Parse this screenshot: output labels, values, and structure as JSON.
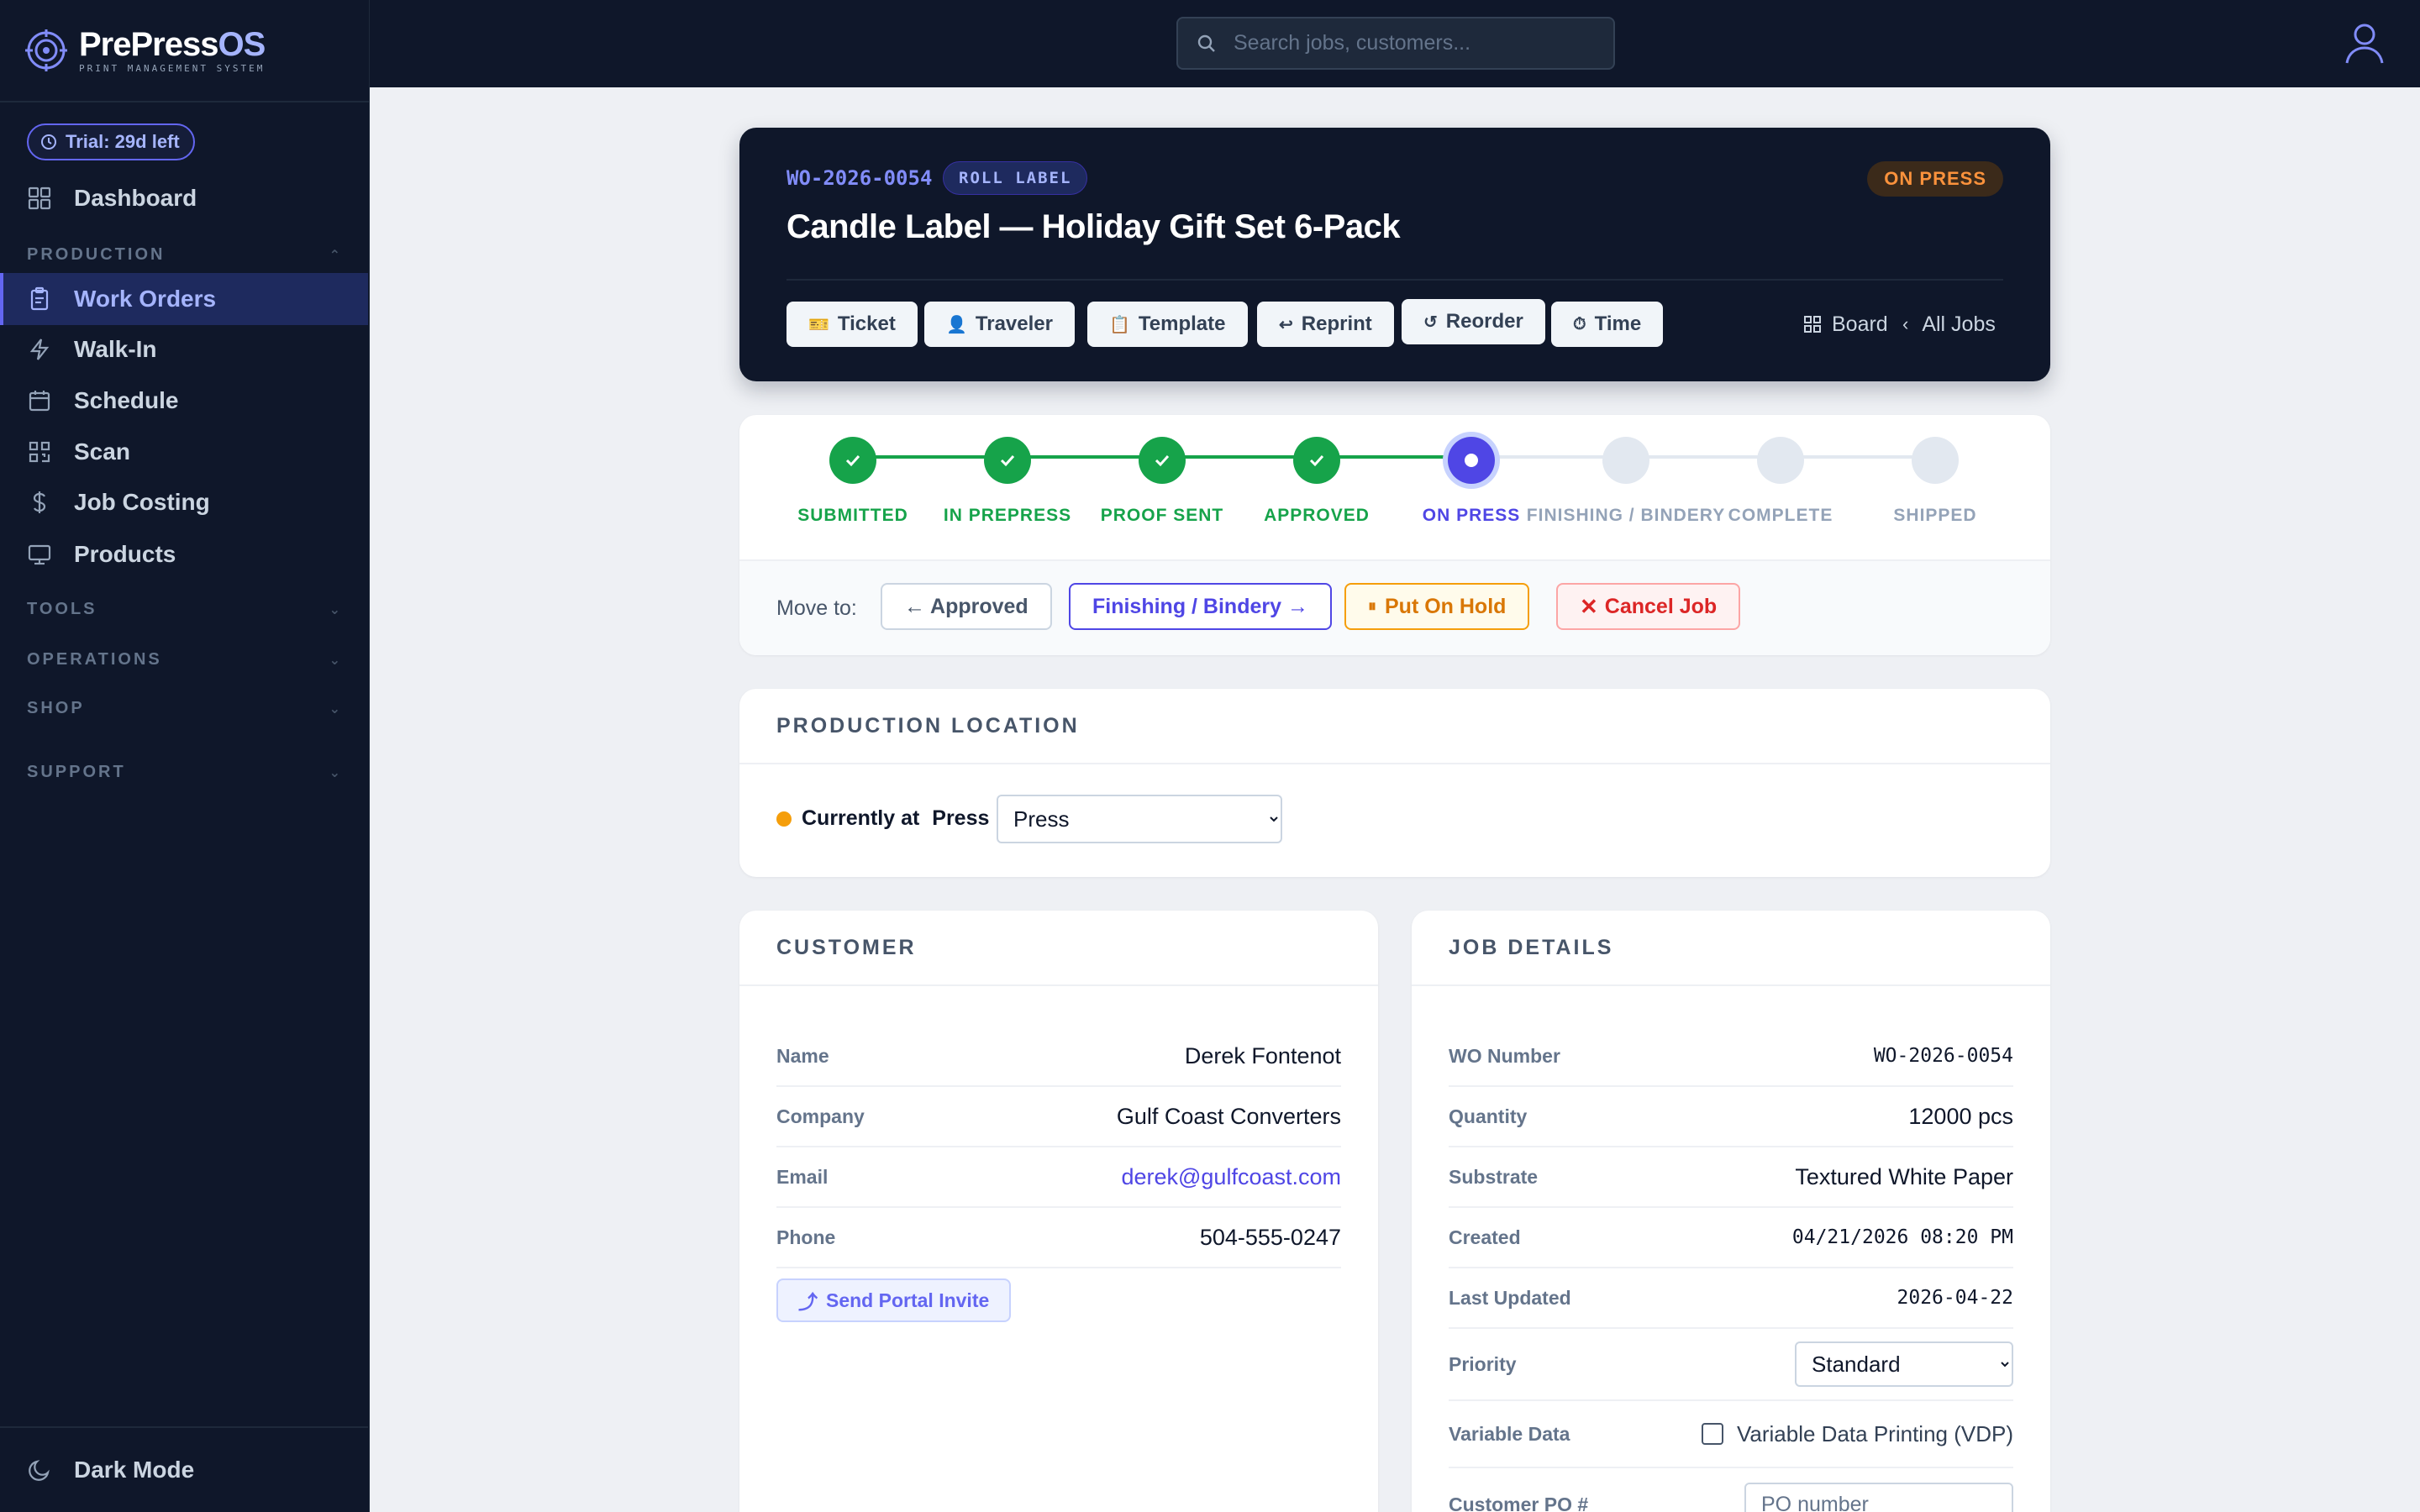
{
  "brand": {
    "name_a": "PrePress",
    "name_b": "OS",
    "tagline": "PRINT MANAGEMENT SYSTEM"
  },
  "sidebar": {
    "trial": "Trial: 29d left",
    "dashboard": "Dashboard",
    "sections": {
      "production": "PRODUCTION",
      "tools": "TOOLS",
      "operations": "OPERATIONS",
      "shop": "SHOP",
      "support": "SUPPORT"
    },
    "items": [
      {
        "label": "Work Orders",
        "icon": "clipboard-icon",
        "active": true
      },
      {
        "label": "Walk-In",
        "icon": "bolt-icon"
      },
      {
        "label": "Schedule",
        "icon": "calendar-icon"
      },
      {
        "label": "Scan",
        "icon": "qr-scan-icon"
      },
      {
        "label": "Job Costing",
        "icon": "dollar-icon"
      },
      {
        "label": "Products",
        "icon": "monitor-icon"
      }
    ],
    "dark_mode": "Dark Mode"
  },
  "topbar": {
    "search_placeholder": "Search jobs, customers..."
  },
  "header": {
    "wo_id": "WO-2026-0054",
    "type": "ROLL LABEL",
    "status": "ON PRESS",
    "title": "Candle Label — Holiday Gift Set 6-Pack",
    "buttons": [
      {
        "label": "Ticket",
        "icon": "🎫"
      },
      {
        "label": "Traveler",
        "icon": "👤"
      },
      {
        "label": "Template",
        "icon": "📋"
      },
      {
        "label": "Reprint",
        "icon": "↩"
      },
      {
        "label": "Reorder",
        "icon": "↺"
      },
      {
        "label": "Time",
        "icon": "⏱"
      }
    ],
    "board": "Board",
    "all_jobs": "All Jobs"
  },
  "pipeline": {
    "steps": [
      {
        "label": "SUBMITTED",
        "state": "done"
      },
      {
        "label": "IN PREPRESS",
        "state": "done"
      },
      {
        "label": "PROOF SENT",
        "state": "done"
      },
      {
        "label": "APPROVED",
        "state": "done"
      },
      {
        "label": "ON PRESS",
        "state": "current"
      },
      {
        "label": "FINISHING / BINDERY",
        "state": "todo"
      },
      {
        "label": "COMPLETE",
        "state": "todo"
      },
      {
        "label": "SHIPPED",
        "state": "todo"
      }
    ],
    "move_to": "Move to:",
    "back": "← Approved",
    "forward": "Finishing / Bindery →",
    "hold": "Put On Hold",
    "cancel": "Cancel Job"
  },
  "location": {
    "heading": "PRODUCTION LOCATION",
    "currently_at": "Currently at",
    "current": "Press",
    "selected": "Press"
  },
  "customer": {
    "heading": "CUSTOMER",
    "rows": [
      {
        "k": "Name",
        "v": "Derek Fontenot"
      },
      {
        "k": "Company",
        "v": "Gulf Coast Converters"
      },
      {
        "k": "Email",
        "v": "derek@gulfcoast.com"
      },
      {
        "k": "Phone",
        "v": "504-555-0247"
      }
    ],
    "portal_invite": "Send Portal Invite"
  },
  "job": {
    "heading": "JOB DETAILS",
    "rows": [
      {
        "k": "WO Number",
        "v": "WO-2026-0054"
      },
      {
        "k": "Quantity",
        "v": "12000 pcs"
      },
      {
        "k": "Substrate",
        "v": "Textured White Paper"
      },
      {
        "k": "Created",
        "v": "04/21/2026 08:20 PM"
      },
      {
        "k": "Last Updated",
        "v": "2026-04-22"
      }
    ],
    "priority_label": "Priority",
    "priority_value": "Standard",
    "vdp_label": "Variable Data",
    "vdp_option": "Variable Data Printing (VDP)",
    "po_label": "Customer PO #",
    "po_placeholder": "PO number"
  },
  "colors": {
    "sidebar_bg": "#0f172a",
    "accent": "#4f46e5",
    "done": "#16a34a",
    "status_orange": "#fb923c"
  }
}
